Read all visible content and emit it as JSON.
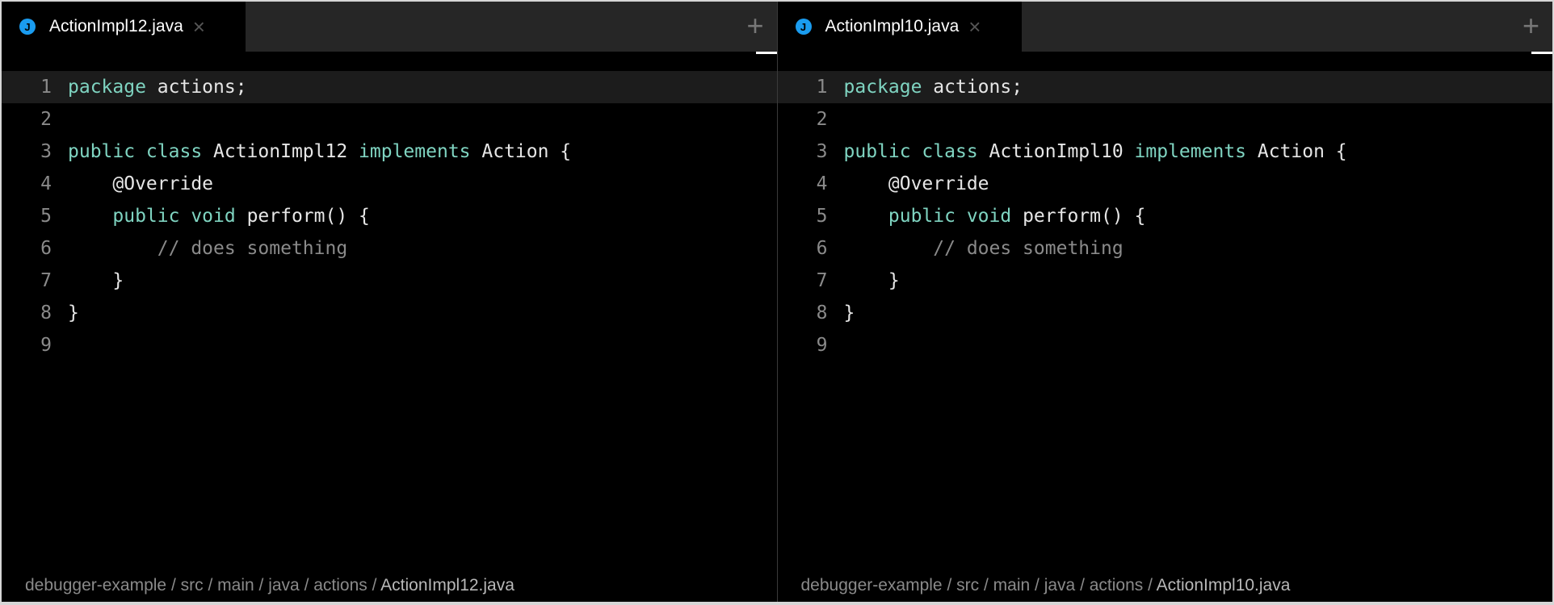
{
  "colors": {
    "keyword": "#7fd4c1",
    "text": "#e6e6e6",
    "comment": "#8a8a8a",
    "file_icon": "#1a9cf0"
  },
  "panes": [
    {
      "tab": {
        "icon": "J",
        "label": "ActionImpl12.java",
        "close": "×"
      },
      "new_tab": "+",
      "current_line": 1,
      "lines": [
        [
          [
            "kw",
            "package"
          ],
          [
            "t",
            " actions;"
          ]
        ],
        [],
        [
          [
            "kw",
            "public class"
          ],
          [
            "t",
            " ActionImpl12 "
          ],
          [
            "kw",
            "implements"
          ],
          [
            "t",
            " Action {"
          ]
        ],
        [
          [
            "t",
            "    @Override"
          ]
        ],
        [
          [
            "t",
            "    "
          ],
          [
            "kw",
            "public void"
          ],
          [
            "t",
            " perform() {"
          ]
        ],
        [
          [
            "t",
            "        "
          ],
          [
            "cm",
            "// does something"
          ]
        ],
        [
          [
            "t",
            "    }"
          ]
        ],
        [
          [
            "t",
            "}"
          ]
        ],
        []
      ],
      "breadcrumb": [
        "debugger-example",
        "src",
        "main",
        "java",
        "actions",
        "ActionImpl12.java"
      ]
    },
    {
      "tab": {
        "icon": "J",
        "label": "ActionImpl10.java",
        "close": "×"
      },
      "new_tab": "+",
      "current_line": 1,
      "lines": [
        [
          [
            "kw",
            "package"
          ],
          [
            "t",
            " actions;"
          ]
        ],
        [],
        [
          [
            "kw",
            "public class"
          ],
          [
            "t",
            " ActionImpl10 "
          ],
          [
            "kw",
            "implements"
          ],
          [
            "t",
            " Action {"
          ]
        ],
        [
          [
            "t",
            "    @Override"
          ]
        ],
        [
          [
            "t",
            "    "
          ],
          [
            "kw",
            "public void"
          ],
          [
            "t",
            " perform() {"
          ]
        ],
        [
          [
            "t",
            "        "
          ],
          [
            "cm",
            "// does something"
          ]
        ],
        [
          [
            "t",
            "    }"
          ]
        ],
        [
          [
            "t",
            "}"
          ]
        ],
        []
      ],
      "breadcrumb": [
        "debugger-example",
        "src",
        "main",
        "java",
        "actions",
        "ActionImpl10.java"
      ]
    }
  ],
  "breadcrumb_separator": " / "
}
